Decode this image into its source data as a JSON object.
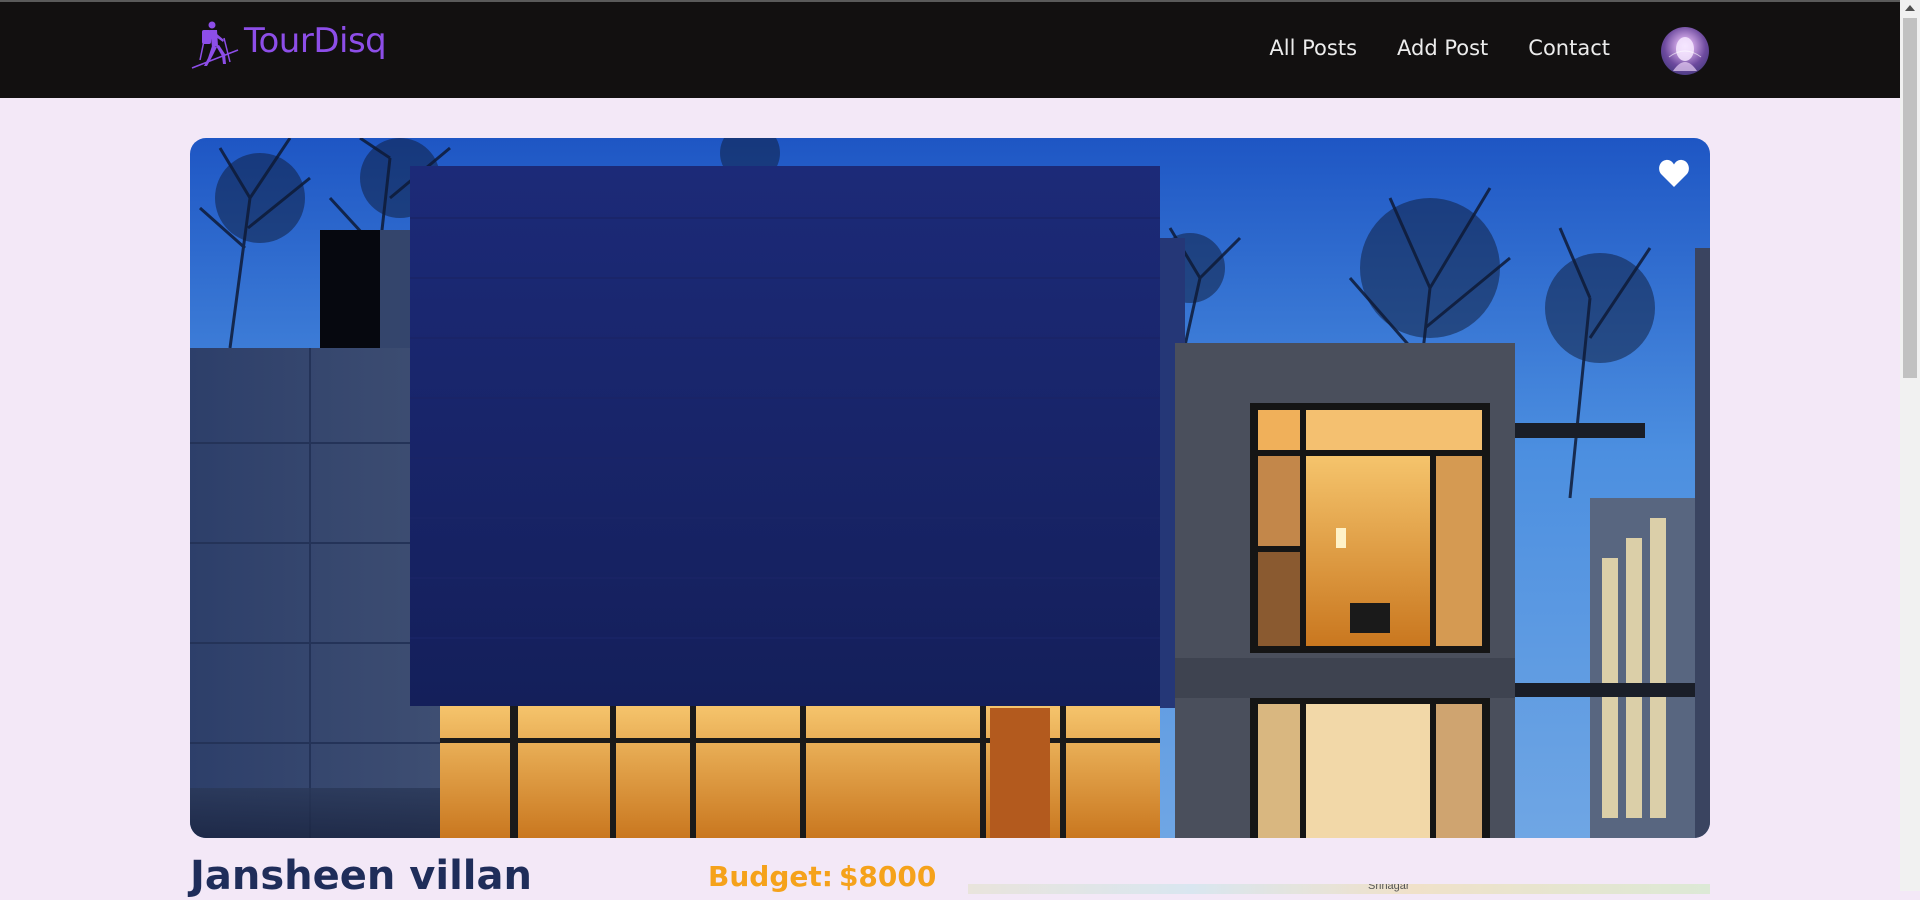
{
  "navbar": {
    "brand_name": "TourDisq",
    "links": [
      {
        "label": "All Posts"
      },
      {
        "label": "Add Post"
      },
      {
        "label": "Contact"
      }
    ]
  },
  "post": {
    "title": "Jansheen villan",
    "budget_label": "Budget:",
    "budget_value": "$8000",
    "favorited": false
  },
  "map": {
    "place_label": "Srinagar"
  },
  "colors": {
    "navbar_bg": "#121010",
    "page_bg": "#f3e8f7",
    "brand": "#8d4ee8",
    "title": "#1f2d5a",
    "budget": "#f5a21b"
  },
  "icons": {
    "logo": "hiker-icon",
    "favorite": "heart-icon"
  }
}
